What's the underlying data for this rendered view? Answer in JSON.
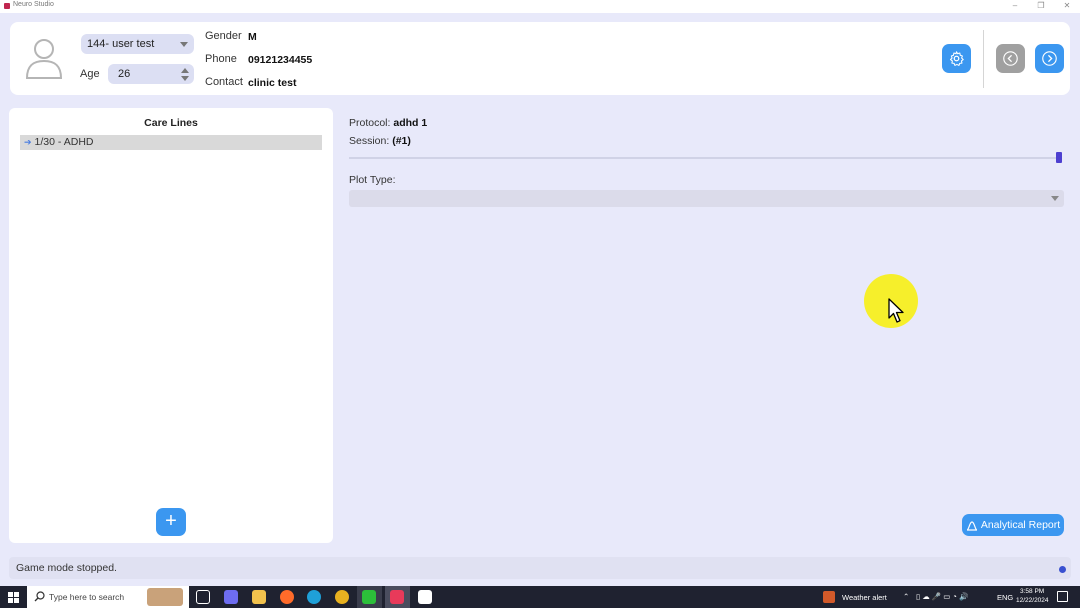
{
  "window": {
    "title": "Neuro Studio",
    "minimize": "–",
    "restore": "❐",
    "close": "✕"
  },
  "patient": {
    "user_select_value": "144- user test",
    "age_label": "Age",
    "age_value": "26",
    "gender_label": "Gender",
    "gender_value": "M",
    "phone_label": "Phone",
    "phone_value": "09121234455",
    "contact_label": "Contact",
    "contact_value": "clinic test"
  },
  "care_lines": {
    "title": "Care Lines",
    "items": [
      {
        "label": "1/30  - ADHD"
      }
    ],
    "add_label": "+"
  },
  "session": {
    "protocol_label": "Protocol:",
    "protocol_value": "adhd 1",
    "session_label": "Session:",
    "session_value": "(#1)",
    "plot_type_label": "Plot Type:",
    "slider_fraction": 1.0
  },
  "report_button": "Analytical Report",
  "status": {
    "text": "Game mode stopped."
  },
  "taskbar": {
    "search_placeholder": "Type here to search",
    "weather": "Weather alert",
    "lang": "ENG",
    "time": "3:58 PM",
    "date": "12/22/2024"
  },
  "colors": {
    "accent": "#3b97f0",
    "background": "#e8e9fa",
    "status_dot": "#3950d0",
    "cursor_highlight": "#f7ef20"
  }
}
